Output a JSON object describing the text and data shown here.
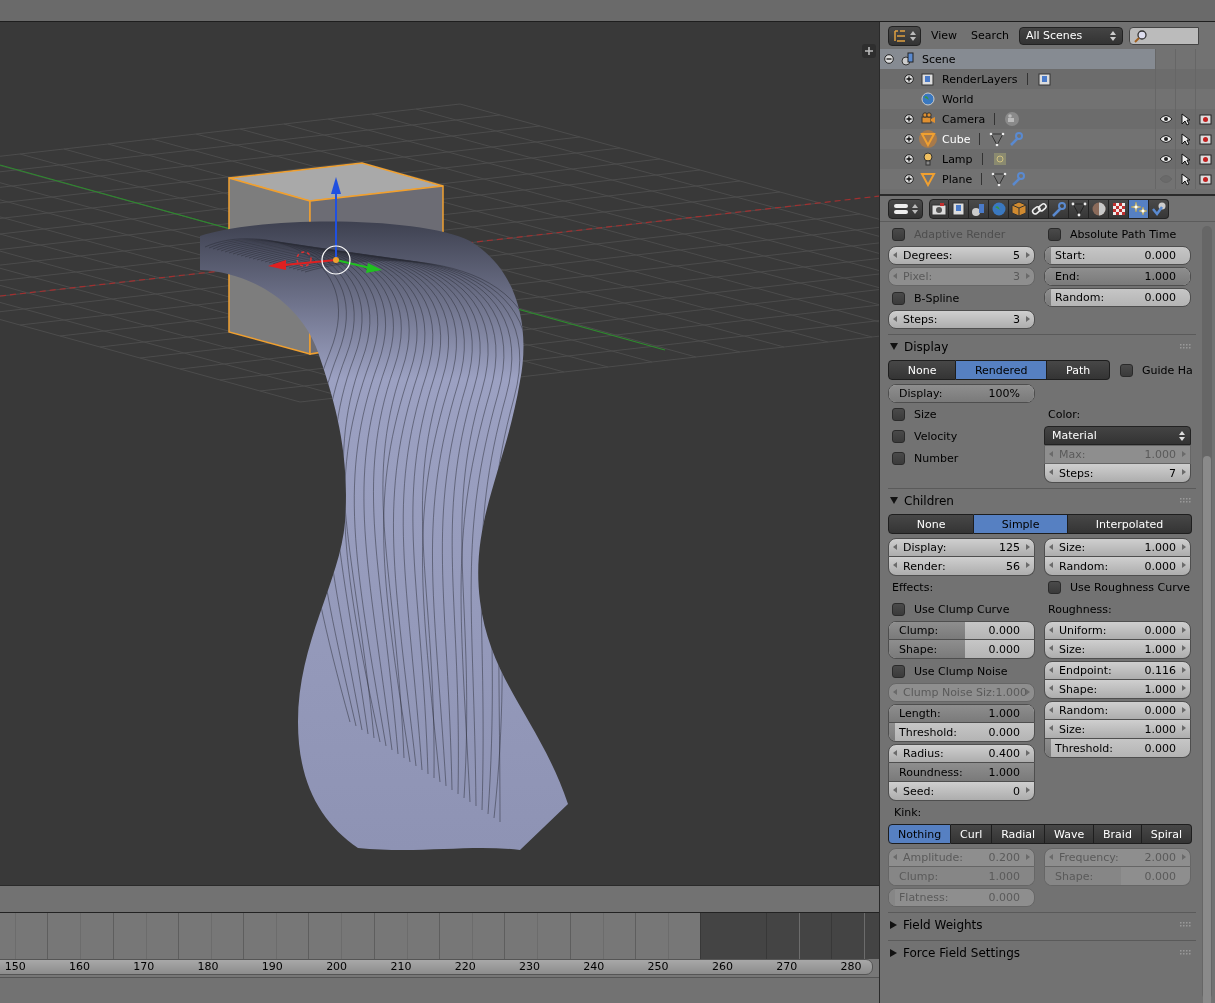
{
  "outliner": {
    "menus": [
      "View",
      "Search"
    ],
    "scene_filter": "All Scenes",
    "tree": [
      {
        "label": "Scene",
        "kind": "scene",
        "expanded": true,
        "selected": true,
        "children": [
          {
            "label": "RenderLayers",
            "kind": "render_layers",
            "expanded": false,
            "selected": false,
            "data_icons": [
              {
                "kind": "render_layers"
              }
            ]
          },
          {
            "label": "World",
            "kind": "world",
            "selected": false
          },
          {
            "label": "Camera",
            "kind": "camera",
            "expanded": false,
            "selected": false,
            "active": false,
            "visible": true,
            "data_icons": [
              {
                "kind": "camera_data"
              }
            ]
          },
          {
            "label": "Cube",
            "kind": "mesh",
            "expanded": false,
            "selected": false,
            "active": true,
            "visible": true,
            "data_icons": [
              {
                "kind": "mesh_data"
              },
              {
                "kind": "modifier"
              }
            ]
          },
          {
            "label": "Lamp",
            "kind": "lamp",
            "expanded": false,
            "selected": false,
            "active": false,
            "visible": true,
            "data_icons": [
              {
                "kind": "lamp_data"
              }
            ]
          },
          {
            "label": "Plane",
            "kind": "mesh",
            "expanded": false,
            "selected": false,
            "active": false,
            "visible": false,
            "data_icons": [
              {
                "kind": "mesh_data"
              },
              {
                "kind": "modifier"
              }
            ]
          }
        ]
      }
    ]
  },
  "properties": {
    "tabs": [
      {
        "kind": "render",
        "selected": false
      },
      {
        "kind": "render_layers",
        "selected": false
      },
      {
        "kind": "scene",
        "selected": false
      },
      {
        "kind": "world",
        "selected": false
      },
      {
        "kind": "object",
        "selected": false
      },
      {
        "kind": "constraints",
        "selected": false
      },
      {
        "kind": "modifiers",
        "selected": false
      },
      {
        "kind": "data",
        "selected": false
      },
      {
        "kind": "material",
        "selected": false
      },
      {
        "kind": "texture",
        "selected": false
      },
      {
        "kind": "particles",
        "selected": true
      },
      {
        "kind": "physics",
        "selected": false
      }
    ],
    "sections": [
      {
        "rows": [
          {
            "kind": "columns",
            "left": [
              {
                "kind": "checkbox",
                "label": "Adaptive Render",
                "checked": false,
                "disabled": true
              },
              {
                "kind": "group",
                "fields": [
                  {
                    "label": "Degrees:",
                    "value": "5",
                    "kind": "arrows",
                    "disabled": false
                  }
                ]
              },
              {
                "kind": "group",
                "fields": [
                  {
                    "label": "Pixel:",
                    "value": "3",
                    "kind": "arrows",
                    "disabled": true
                  }
                ]
              },
              {
                "kind": "checkbox",
                "label": "B-Spline",
                "checked": false,
                "disabled": false
              },
              {
                "kind": "group",
                "fields": [
                  {
                    "label": "Steps:",
                    "value": "3",
                    "kind": "arrows",
                    "disabled": false
                  }
                ]
              }
            ],
            "right": [
              {
                "kind": "checkbox",
                "label": "Absolute Path Time",
                "checked": false,
                "disabled": false
              },
              {
                "kind": "group",
                "fields": [
                  {
                    "label": "Start:",
                    "value": "0.000",
                    "kind": "slider",
                    "level": 0,
                    "disabled": false
                  }
                ]
              },
              {
                "kind": "group",
                "fields": [
                  {
                    "label": "End:",
                    "value": "1.000",
                    "kind": "slider",
                    "level": 1,
                    "disabled": false
                  }
                ]
              },
              {
                "kind": "group",
                "fields": [
                  {
                    "label": "Random:",
                    "value": "0.000",
                    "kind": "slider",
                    "level": 0,
                    "disabled": false
                  }
                ]
              }
            ]
          }
        ]
      },
      {
        "title": "Display",
        "expanded": true,
        "rows": [
          {
            "kind": "enum",
            "options": [
              {
                "label": "None",
                "selected": false
              },
              {
                "label": "Rendered",
                "selected": true
              },
              {
                "label": "Path",
                "selected": false
              }
            ],
            "checkbox": {
              "label": "Guide Ha",
              "checked": false,
              "disabled": false
            }
          },
          {
            "kind": "columns",
            "left": [
              {
                "kind": "group",
                "fields": [
                  {
                    "label": "Display:",
                    "value": "100%",
                    "kind": "slider",
                    "level": 1,
                    "disabled": false
                  }
                ]
              }
            ]
          },
          {
            "kind": "columns",
            "left": [
              {
                "kind": "checkbox",
                "label": "Size",
                "checked": false,
                "disabled": false
              },
              {
                "kind": "checkbox",
                "label": "Velocity",
                "checked": false,
                "disabled": false
              },
              {
                "kind": "checkbox",
                "label": "Number",
                "checked": false,
                "disabled": false
              }
            ],
            "right": [
              {
                "kind": "label",
                "text": "Color:"
              },
              {
                "kind": "dropdown",
                "value": "Material"
              },
              {
                "kind": "group",
                "fields": [
                  {
                    "label": "Max:",
                    "value": "1.000",
                    "kind": "arrows",
                    "disabled": true
                  },
                  {
                    "label": "Steps:",
                    "value": "7",
                    "kind": "arrows",
                    "disabled": false
                  }
                ]
              }
            ]
          }
        ]
      },
      {
        "title": "Children",
        "expanded": true,
        "rows": [
          {
            "kind": "enum",
            "options": [
              {
                "label": "None",
                "selected": false
              },
              {
                "label": "Simple",
                "selected": true
              },
              {
                "label": "Interpolated",
                "selected": false
              }
            ]
          },
          {
            "kind": "columns",
            "left": [
              {
                "kind": "group",
                "fields": [
                  {
                    "label": "Display:",
                    "value": "125",
                    "kind": "arrows",
                    "disabled": false
                  },
                  {
                    "label": "Render:",
                    "value": "56",
                    "kind": "arrows",
                    "disabled": false
                  }
                ]
              }
            ],
            "right": [
              {
                "kind": "group",
                "fields": [
                  {
                    "label": "Size:",
                    "value": "1.000",
                    "kind": "arrows",
                    "disabled": false
                  },
                  {
                    "label": "Random:",
                    "value": "0.000",
                    "kind": "arrows",
                    "disabled": false
                  }
                ]
              }
            ]
          },
          {
            "kind": "columns",
            "left": [
              {
                "kind": "label",
                "text": "Effects:"
              },
              {
                "kind": "checkbox",
                "label": "Use Clump Curve",
                "checked": false,
                "disabled": false
              },
              {
                "kind": "group",
                "fields": [
                  {
                    "label": "Clump:",
                    "value": "0.000",
                    "kind": "slider",
                    "level": 0.5,
                    "disabled": false
                  },
                  {
                    "label": "Shape:",
                    "value": "0.000",
                    "kind": "slider",
                    "level": 0.5,
                    "disabled": false
                  }
                ]
              },
              {
                "kind": "checkbox",
                "label": "Use Clump Noise",
                "checked": false,
                "disabled": false
              },
              {
                "kind": "group",
                "fields": [
                  {
                    "label": "Clump Noise Siz:",
                    "value": "1.000",
                    "kind": "arrows",
                    "disabled": true
                  }
                ]
              },
              {
                "kind": "group",
                "fields": [
                  {
                    "label": "Length:",
                    "value": "1.000",
                    "kind": "slider",
                    "level": 1,
                    "disabled": false
                  },
                  {
                    "label": "Threshold:",
                    "value": "0.000",
                    "kind": "slider",
                    "level": 0,
                    "disabled": false
                  }
                ]
              },
              {
                "kind": "group",
                "fields": [
                  {
                    "label": "Radius:",
                    "value": "0.400",
                    "kind": "arrows",
                    "disabled": false
                  },
                  {
                    "label": "Roundness:",
                    "value": "1.000",
                    "kind": "slider",
                    "level": 1,
                    "disabled": false
                  },
                  {
                    "label": "Seed:",
                    "value": "0",
                    "kind": "arrows",
                    "disabled": false
                  }
                ]
              }
            ],
            "right": [
              {
                "kind": "checkbox",
                "label": "Use Roughness Curve",
                "checked": false,
                "disabled": false
              },
              {
                "kind": "label",
                "text": "Roughness:"
              },
              {
                "kind": "group",
                "fields": [
                  {
                    "label": "Uniform:",
                    "value": "0.000",
                    "kind": "arrows",
                    "disabled": false
                  },
                  {
                    "label": "Size:",
                    "value": "1.000",
                    "kind": "arrows",
                    "disabled": false
                  }
                ]
              },
              {
                "kind": "group",
                "fields": [
                  {
                    "label": "Endpoint:",
                    "value": "0.116",
                    "kind": "arrows",
                    "disabled": false
                  },
                  {
                    "label": "Shape:",
                    "value": "1.000",
                    "kind": "arrows",
                    "disabled": false
                  }
                ]
              },
              {
                "kind": "group",
                "fields": [
                  {
                    "label": "Random:",
                    "value": "0.000",
                    "kind": "arrows",
                    "disabled": false
                  },
                  {
                    "label": "Size:",
                    "value": "1.000",
                    "kind": "arrows",
                    "disabled": false
                  },
                  {
                    "label": "Threshold:",
                    "value": "0.000",
                    "kind": "slider",
                    "level": 0,
                    "disabled": false
                  }
                ]
              }
            ]
          },
          {
            "kind": "label",
            "text": "Kink:"
          },
          {
            "kind": "enum",
            "options": [
              {
                "label": "Nothing",
                "selected": true
              },
              {
                "label": "Curl",
                "selected": false
              },
              {
                "label": "Radial",
                "selected": false
              },
              {
                "label": "Wave",
                "selected": false
              },
              {
                "label": "Braid",
                "selected": false
              },
              {
                "label": "Spiral",
                "selected": false
              }
            ]
          },
          {
            "kind": "columns",
            "left": [
              {
                "kind": "group",
                "fields": [
                  {
                    "label": "Amplitude:",
                    "value": "0.200",
                    "kind": "arrows",
                    "disabled": true
                  },
                  {
                    "label": "Clump:",
                    "value": "1.000",
                    "kind": "slider",
                    "level": 1,
                    "disabled": true
                  }
                ]
              },
              {
                "kind": "group",
                "fields": [
                  {
                    "label": "Flatness:",
                    "value": "0.000",
                    "kind": "slider",
                    "level": 0,
                    "disabled": true
                  }
                ]
              }
            ],
            "right": [
              {
                "kind": "group",
                "fields": [
                  {
                    "label": "Frequency:",
                    "value": "2.000",
                    "kind": "arrows",
                    "disabled": true
                  },
                  {
                    "label": "Shape:",
                    "value": "0.000",
                    "kind": "slider",
                    "level": 0.5,
                    "disabled": true
                  }
                ]
              }
            ]
          }
        ]
      },
      {
        "title": "Field Weights",
        "expanded": false
      },
      {
        "title": "Force Field Settings",
        "expanded": false
      }
    ]
  },
  "timeline": {
    "frames": [
      {
        "label": "150",
        "in_range": true
      },
      {
        "label": "160",
        "in_range": true
      },
      {
        "label": "170",
        "in_range": true
      },
      {
        "label": "180",
        "in_range": true
      },
      {
        "label": "190",
        "in_range": true
      },
      {
        "label": "200",
        "in_range": true
      },
      {
        "label": "210",
        "in_range": true
      },
      {
        "label": "220",
        "in_range": true
      },
      {
        "label": "230",
        "in_range": true
      },
      {
        "label": "240",
        "in_range": true
      },
      {
        "label": "250",
        "in_range": true
      },
      {
        "label": "260",
        "in_range": false
      },
      {
        "label": "270",
        "in_range": false
      },
      {
        "label": "280",
        "in_range": false
      }
    ]
  }
}
